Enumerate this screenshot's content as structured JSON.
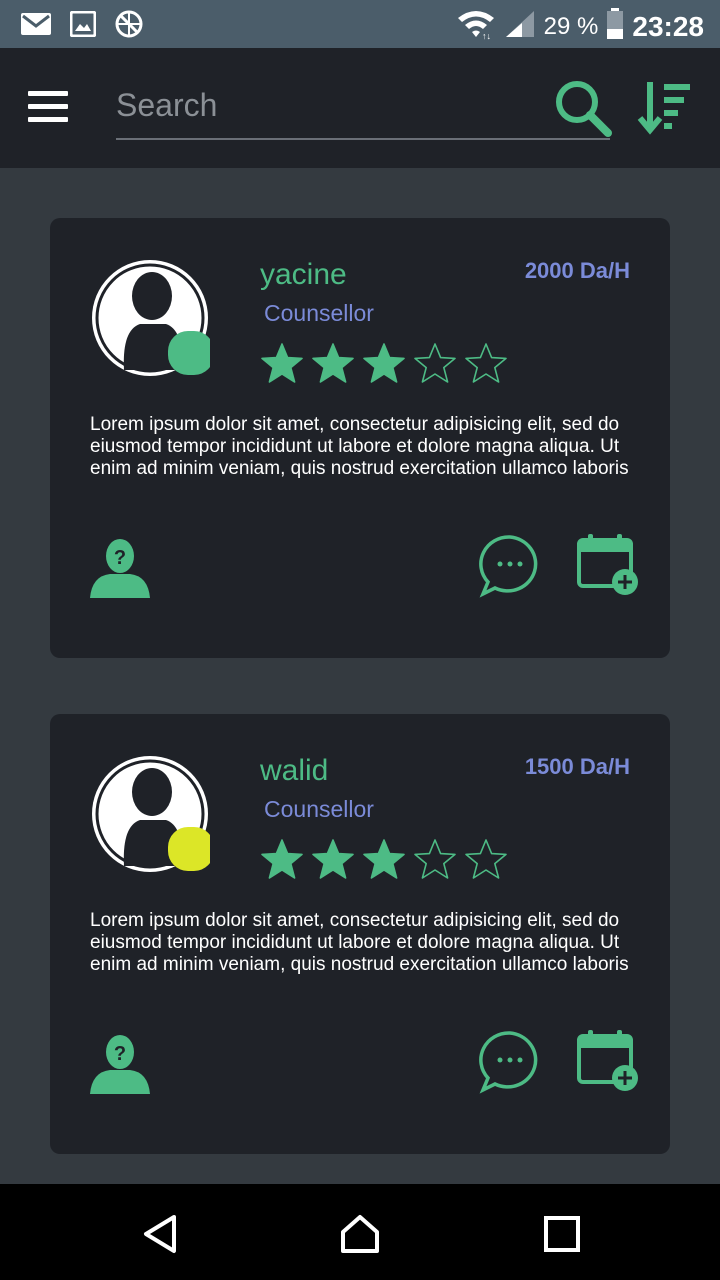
{
  "status_bar": {
    "battery": "29 %",
    "time": "23:28",
    "icons": [
      "mail-icon",
      "image-icon",
      "network-blocked-icon",
      "wifi-icon",
      "signal-icon",
      "battery-icon"
    ]
  },
  "app_bar": {
    "search_placeholder": "Search",
    "search_value": "",
    "icons": [
      "menu-icon",
      "search-icon",
      "sort-icon"
    ]
  },
  "colors": {
    "accent_green": "#4dbb85",
    "accent_blue": "#7b8bd8",
    "card_bg": "#1f2228",
    "page_bg": "#343a40",
    "status_online": "#4dbb85",
    "status_away": "#dce627"
  },
  "counsellors": [
    {
      "name": "yacine",
      "role": "Counsellor",
      "price": "2000 Da/H",
      "rating": 3,
      "rating_max": 5,
      "status_color": "#4dbb85",
      "description": "Lorem ipsum dolor sit amet, consectetur adipisicing elit, sed do eiusmod tempor incididunt ut labore et dolore magna aliqua. Ut enim ad minim veniam, quis nostrud exercitation ullamco laboris"
    },
    {
      "name": "walid",
      "role": "Counsellor",
      "price": "1500 Da/H",
      "rating": 3,
      "rating_max": 5,
      "status_color": "#dce627",
      "description": "Lorem ipsum dolor sit amet, consectetur adipisicing elit, sed do eiusmod tempor incididunt ut labore et dolore magna aliqua. Ut enim ad minim veniam, quis nostrud exercitation ullamco laboris"
    }
  ],
  "nav_bar": {
    "icons": [
      "back-icon",
      "home-icon",
      "recents-icon"
    ]
  }
}
